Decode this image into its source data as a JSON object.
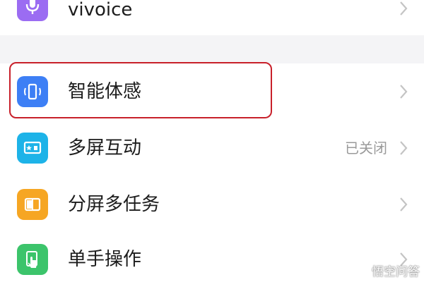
{
  "settings_list": {
    "items": [
      {
        "label": "vivoice",
        "icon": "microphone-icon",
        "icon_color": "#9b6cf2",
        "status": ""
      },
      {
        "label": "智能体感",
        "icon": "phone-motion-icon",
        "icon_color": "#3d7ff5",
        "status": ""
      },
      {
        "label": "多屏互动",
        "icon": "screen-cast-icon",
        "icon_color": "#1db3e8",
        "status": "已关闭"
      },
      {
        "label": "分屏多任务",
        "icon": "split-screen-icon",
        "icon_color": "#f6a623",
        "status": ""
      },
      {
        "label": "单手操作",
        "icon": "one-hand-icon",
        "icon_color": "#3cc46b",
        "status": ""
      }
    ]
  },
  "watermark": {
    "text": "悟空问答",
    "icon": "chat-bubble-icon"
  },
  "colors": {
    "highlight_border": "#c8202a",
    "section_gap": "#f4f4f6",
    "chevron": "#c4c4c4"
  }
}
